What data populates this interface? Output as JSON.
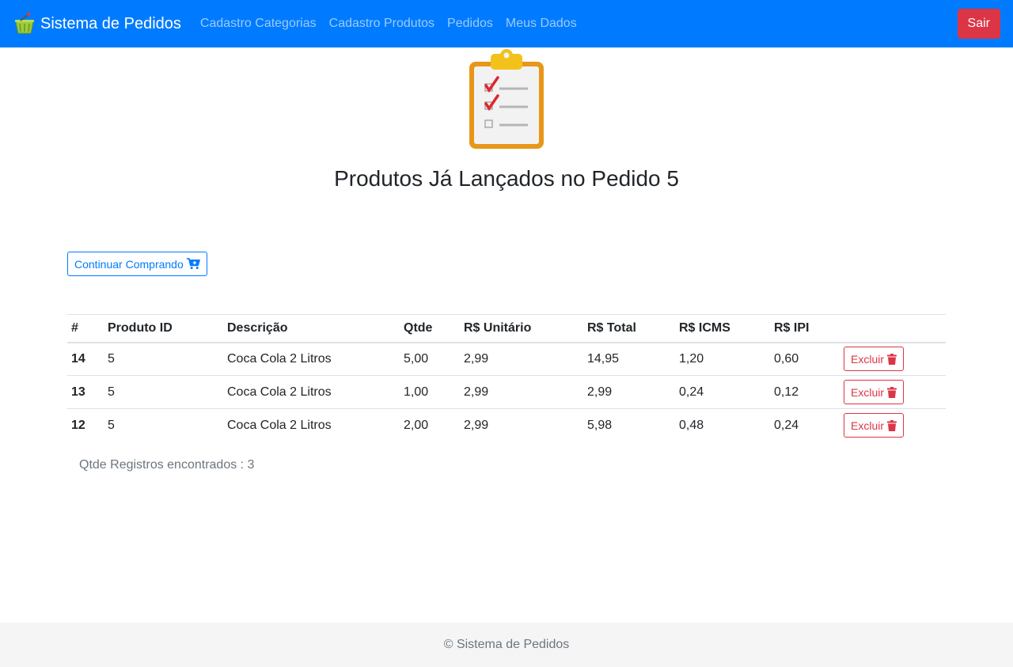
{
  "navbar": {
    "brand": "Sistema de Pedidos",
    "brand_icon": "basket-icon",
    "links": [
      {
        "label": "Cadastro Categorias"
      },
      {
        "label": "Cadastro Produtos"
      },
      {
        "label": "Pedidos"
      },
      {
        "label": "Meus Dados"
      }
    ],
    "logout_label": "Sair",
    "color": "#007bff"
  },
  "hero_icon": "clipboard-checklist-icon",
  "page_title": "Produtos Já Lançados no Pedido 5",
  "continue_button": {
    "label": "Continuar Comprando",
    "icon": "cart-plus-icon"
  },
  "table": {
    "headers": [
      "#",
      "Produto ID",
      "Descrição",
      "Qtde",
      "R$ Unitário",
      "R$ Total",
      "R$ ICMS",
      "R$ IPI",
      ""
    ],
    "rows": [
      {
        "id": "14",
        "produto_id": "5",
        "descricao": "Coca Cola 2 Litros",
        "qtde": "5,00",
        "unitario": "2,99",
        "total": "14,95",
        "icms": "1,20",
        "ipi": "0,60",
        "action": "Excluir"
      },
      {
        "id": "13",
        "produto_id": "5",
        "descricao": "Coca Cola 2 Litros",
        "qtde": "1,00",
        "unitario": "2,99",
        "total": "2,99",
        "icms": "0,24",
        "ipi": "0,12",
        "action": "Excluir"
      },
      {
        "id": "12",
        "produto_id": "5",
        "descricao": "Coca Cola 2 Litros",
        "qtde": "2,00",
        "unitario": "2,99",
        "total": "5,98",
        "icms": "0,48",
        "ipi": "0,24",
        "action": "Excluir"
      }
    ]
  },
  "records_count": "Qtde Registros encontrados : 3",
  "footer": "© Sistema de Pedidos",
  "colors": {
    "primary": "#007bff",
    "danger": "#dc3545"
  }
}
